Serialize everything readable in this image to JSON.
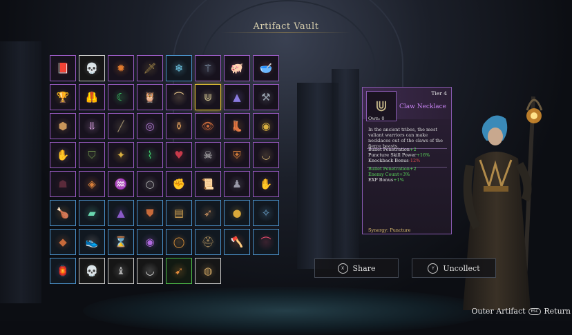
{
  "title": "Artifact Vault",
  "grid": {
    "items": [
      {
        "icon": "spellbook-icon",
        "rarity": "purple",
        "glyph": "📕",
        "color": "#9a2f2f"
      },
      {
        "icon": "skull-mask-icon",
        "rarity": "white",
        "glyph": "💀",
        "color": "#d6d6d6"
      },
      {
        "icon": "fire-orb-icon",
        "rarity": "purple",
        "glyph": "✹",
        "color": "#e07a2e"
      },
      {
        "icon": "dagger-icon",
        "rarity": "purple",
        "glyph": "🗡",
        "color": "#a58a4a"
      },
      {
        "icon": "ice-shards-icon",
        "rarity": "blue",
        "glyph": "❄",
        "color": "#6fc9e8"
      },
      {
        "icon": "trident-icon",
        "rarity": "purple",
        "glyph": "⚚",
        "color": "#9ab0c8"
      },
      {
        "icon": "pig-icon",
        "rarity": "purple",
        "glyph": "🐖",
        "color": "#e8a0b8"
      },
      {
        "icon": "soup-bowl-icon",
        "rarity": "purple",
        "glyph": "🥣",
        "color": "#e05a4a"
      },
      {
        "icon": "golden-chalice-icon",
        "rarity": "purple",
        "glyph": "🏆",
        "color": "#d9a83a"
      },
      {
        "icon": "leather-armor-icon",
        "rarity": "purple",
        "glyph": "🦺",
        "color": "#9a6a3a"
      },
      {
        "icon": "green-scythe-icon",
        "rarity": "purple",
        "glyph": "☾",
        "color": "#3fcf6a"
      },
      {
        "icon": "owl-icon",
        "rarity": "purple",
        "glyph": "🦉",
        "color": "#8fa06a"
      },
      {
        "icon": "fang-icon",
        "rarity": "purple",
        "glyph": "⌒",
        "color": "#e6c48a"
      },
      {
        "icon": "claw-necklace-icon",
        "rarity": "purple",
        "glyph": "⋓",
        "color": "#c7b98a",
        "selected": true
      },
      {
        "icon": "pyramid-icon",
        "rarity": "purple",
        "glyph": "▲",
        "color": "#8a7ae0"
      },
      {
        "icon": "anvil-icon",
        "rarity": "purple",
        "glyph": "⚒",
        "color": "#9aa4b0"
      },
      {
        "icon": "rune-stone-icon",
        "rarity": "purple",
        "glyph": "⬢",
        "color": "#c8965a"
      },
      {
        "icon": "unicorn-horn-icon",
        "rarity": "purple",
        "glyph": "⥥",
        "color": "#d8a0e0"
      },
      {
        "icon": "scroll-stick-icon",
        "rarity": "purple",
        "glyph": "╱",
        "color": "#9a8a6a"
      },
      {
        "icon": "bracelet-icon",
        "rarity": "purple",
        "glyph": "◎",
        "color": "#b07ad0"
      },
      {
        "icon": "potion-jar-icon",
        "rarity": "purple",
        "glyph": "⚱",
        "color": "#d89a5a"
      },
      {
        "icon": "eye-icon",
        "rarity": "purple",
        "glyph": "👁",
        "color": "#c86a3a"
      },
      {
        "icon": "boots-icon",
        "rarity": "purple",
        "glyph": "👢",
        "color": "#c8863a"
      },
      {
        "icon": "gold-mask-icon",
        "rarity": "purple",
        "glyph": "◉",
        "color": "#d9b040"
      },
      {
        "icon": "gauntlet-icon",
        "rarity": "purple",
        "glyph": "✋",
        "color": "#c8c0b0"
      },
      {
        "icon": "cloak-icon",
        "rarity": "purple",
        "glyph": "⛉",
        "color": "#6a8a4a"
      },
      {
        "icon": "winged-emblem-icon",
        "rarity": "purple",
        "glyph": "✦",
        "color": "#d9b040"
      },
      {
        "icon": "green-cloth-icon",
        "rarity": "purple",
        "glyph": "⌇",
        "color": "#3fc86a"
      },
      {
        "icon": "heart-icon",
        "rarity": "purple",
        "glyph": "♥",
        "color": "#c83a4a"
      },
      {
        "icon": "skull-banner-icon",
        "rarity": "purple",
        "glyph": "☠",
        "color": "#d0d0d0"
      },
      {
        "icon": "crest-shield-icon",
        "rarity": "purple",
        "glyph": "⛨",
        "color": "#d9803a"
      },
      {
        "icon": "fang-necklace-icon",
        "rarity": "purple",
        "glyph": "◡",
        "color": "#d0b070"
      },
      {
        "icon": "dark-robe-icon",
        "rarity": "purple",
        "glyph": "☗",
        "color": "#5a2a3a"
      },
      {
        "icon": "eye-shield-icon",
        "rarity": "purple",
        "glyph": "◈",
        "color": "#d9803a"
      },
      {
        "icon": "horn-icon",
        "rarity": "purple",
        "glyph": "♒",
        "color": "#c8864a"
      },
      {
        "icon": "ring-icon",
        "rarity": "purple",
        "glyph": "○",
        "color": "#b0b0b0"
      },
      {
        "icon": "glove-icon",
        "rarity": "purple",
        "glyph": "✊",
        "color": "#7a6ac0"
      },
      {
        "icon": "spell-scroll-icon",
        "rarity": "purple",
        "glyph": "📜",
        "color": "#d08a4a"
      },
      {
        "icon": "hooded-figure-icon",
        "rarity": "purple",
        "glyph": "♟",
        "color": "#9a9aa8"
      },
      {
        "icon": "iron-gauntlet-icon",
        "rarity": "purple",
        "glyph": "✋",
        "color": "#8a8a8a"
      },
      {
        "icon": "roast-chicken-icon",
        "rarity": "blue",
        "glyph": "🍗",
        "color": "#d08a3a"
      },
      {
        "icon": "jade-bar-icon",
        "rarity": "blue",
        "glyph": "▰",
        "color": "#6ad8b0"
      },
      {
        "icon": "wizard-hat-icon",
        "rarity": "blue",
        "glyph": "▲",
        "color": "#8a5ac8"
      },
      {
        "icon": "vest-icon",
        "rarity": "blue",
        "glyph": "⛊",
        "color": "#c86a3a"
      },
      {
        "icon": "map-scroll-icon",
        "rarity": "blue",
        "glyph": "▤",
        "color": "#d0a050"
      },
      {
        "icon": "arrows-icon",
        "rarity": "blue",
        "glyph": "➶",
        "color": "#c89060"
      },
      {
        "icon": "gold-coin-icon",
        "rarity": "blue",
        "glyph": "●",
        "color": "#d9a83a"
      },
      {
        "icon": "compass-icon",
        "rarity": "blue",
        "glyph": "✧",
        "color": "#6aa0c8"
      },
      {
        "icon": "amber-gem-icon",
        "rarity": "blue",
        "glyph": "◆",
        "color": "#c86a3a"
      },
      {
        "icon": "shoes-icon",
        "rarity": "blue",
        "glyph": "👟",
        "color": "#c8b8b0"
      },
      {
        "icon": "hourglass-icon",
        "rarity": "blue",
        "glyph": "⌛",
        "color": "#a0b8c8"
      },
      {
        "icon": "purple-orb-icon",
        "rarity": "blue",
        "glyph": "◉",
        "color": "#b06ae0"
      },
      {
        "icon": "bead-necklace-icon",
        "rarity": "blue",
        "glyph": "◯",
        "color": "#d9903a"
      },
      {
        "icon": "helmet-icon",
        "rarity": "blue",
        "glyph": "⛑",
        "color": "#a88a5a"
      },
      {
        "icon": "axe-icon",
        "rarity": "blue",
        "glyph": "🪓",
        "color": "#e06a3a"
      },
      {
        "icon": "boomerang-icon",
        "rarity": "blue",
        "glyph": "⌒",
        "color": "#e04a6a"
      },
      {
        "icon": "lantern-icon",
        "rarity": "blue",
        "glyph": "🏮",
        "color": "#8a8ae0"
      },
      {
        "icon": "skull-icon",
        "rarity": "white",
        "glyph": "💀",
        "color": "#d8c8a8"
      },
      {
        "icon": "statuette-icon",
        "rarity": "white",
        "glyph": "♝",
        "color": "#b0b0b0"
      },
      {
        "icon": "pearl-necklace-icon",
        "rarity": "white",
        "glyph": "◡",
        "color": "#e0e0e0"
      },
      {
        "icon": "feather-icon",
        "rarity": "green",
        "glyph": "➹",
        "color": "#e08a3a"
      },
      {
        "icon": "mirror-icon",
        "rarity": "white",
        "glyph": "◍",
        "color": "#c8a060"
      }
    ]
  },
  "tooltip": {
    "tier": "Tier 4",
    "name": "Claw Necklace",
    "own": "Own: 0",
    "description": "In the ancient tribes, the most valiant warriors can make necklaces out of the claws of the fierce beasts.",
    "stats": [
      {
        "label": "Bullet Penetration",
        "value": "+2",
        "color": "#e8e8e8",
        "vcolor": "#5cdc5c"
      },
      {
        "label": "Puncture Skill Power",
        "value": "+16%",
        "color": "#e8e8e8",
        "vcolor": "#5cdc5c"
      },
      {
        "label": "Knockback Bonus",
        "value": "-12%",
        "color": "#e8e8e8",
        "vcolor": "#e05050"
      }
    ],
    "bonus": [
      {
        "label": "Bullet Penetration",
        "value": "+2",
        "color": "#5cdc5c",
        "vcolor": "#5cdc5c"
      },
      {
        "label": "Enemy Count",
        "value": "+3%",
        "color": "#5cdc5c",
        "vcolor": "#5cdc5c"
      },
      {
        "label": "EXP Bonus",
        "value": "+1%",
        "color": "#e8e8e8",
        "vcolor": "#5cdc5c"
      }
    ],
    "synergy_label": "Synergy:",
    "synergy_value": "Puncture"
  },
  "buttons": {
    "share": {
      "key": "X",
      "label": "Share"
    },
    "uncollect": {
      "key": "Y",
      "label": "Uncollect"
    }
  },
  "footer": {
    "outer": "Outer Artifact",
    "esc": "ESC",
    "return": "Return"
  },
  "colors": {
    "purple_border": "#9a5bc4",
    "blue_border": "#4a90c8",
    "white_border": "#c9c9c9",
    "green_border": "#4fbf4a",
    "selected_border": "#e4c036"
  }
}
